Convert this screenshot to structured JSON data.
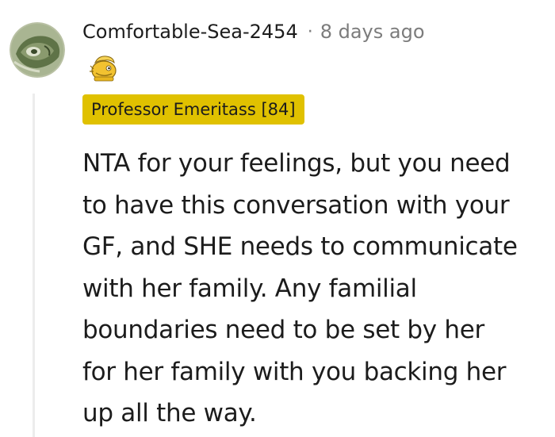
{
  "comment": {
    "username": "Comfortable-Sea-2454",
    "separator": "·",
    "timestamp": "8 days ago",
    "flair": "Professor Emeritass [84]",
    "body_lines": [
      "NTA for your feelings, but you need",
      "to have this conversation with your",
      "GF, and SHE needs to communicate",
      "with her family. Any familial",
      "boundaries need to be set by her",
      "for her family with you backing her",
      "up all the way."
    ]
  },
  "colors": {
    "flair_background": "#e0c100",
    "text": "#1c1c1c",
    "muted": "#7c7c7c",
    "thread_line": "#ececec"
  },
  "icons": {
    "avatar": "user-avatar",
    "award": "award-icon"
  }
}
